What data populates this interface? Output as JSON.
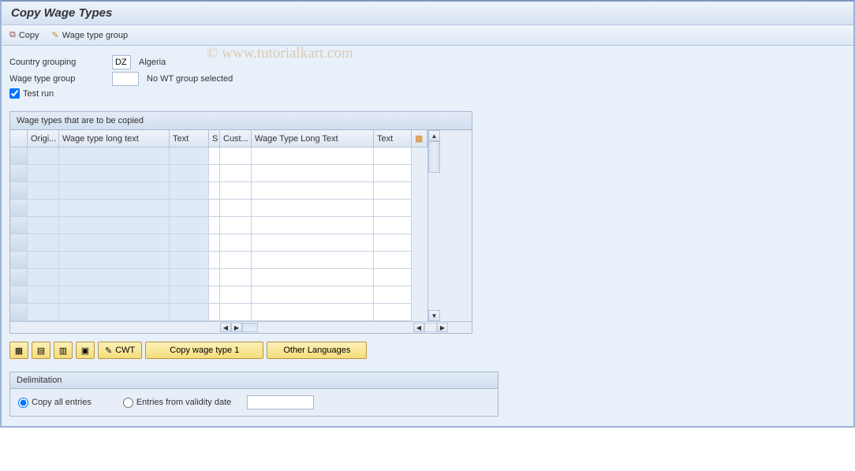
{
  "title": "Copy Wage Types",
  "watermark": "© www.tutorialkart.com",
  "toolbar": {
    "copy": "Copy",
    "wage_type_group": "Wage type group"
  },
  "form": {
    "country_grouping_label": "Country grouping",
    "country_grouping_value": "DZ",
    "country_name": "Algeria",
    "wage_type_group_label": "Wage type group",
    "wage_type_group_value": "",
    "wage_type_group_text": "No WT group selected",
    "test_run_label": "Test run",
    "test_run_checked": true
  },
  "grid": {
    "title": "Wage types that are to be copied",
    "headers": {
      "origi": "Origi...",
      "wtlt": "Wage type long text",
      "text1": "Text",
      "s": "S",
      "cust": "Cust...",
      "wtlt2": "Wage Type Long Text",
      "text2": "Text"
    },
    "row_count": 10
  },
  "buttons": {
    "cwt": "CWT",
    "copy_wage_type_1": "Copy wage type 1",
    "other_languages": "Other Languages"
  },
  "delimitation": {
    "title": "Delimitation",
    "copy_all": "Copy all entries",
    "entries_from": "Entries from validity date",
    "date_value": ""
  }
}
